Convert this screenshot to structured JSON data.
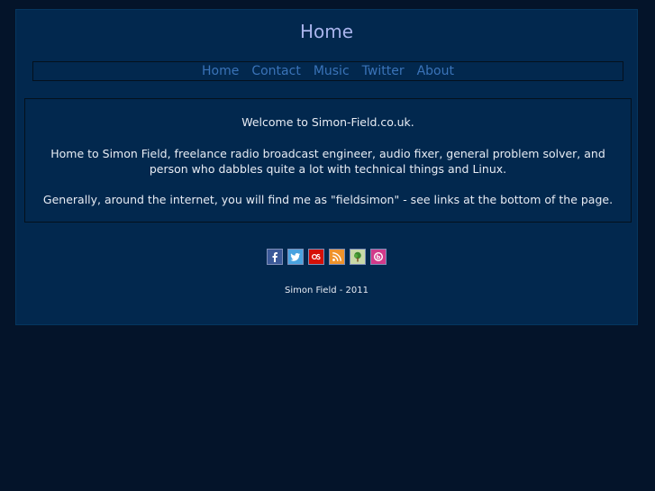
{
  "header": {
    "title": "Home"
  },
  "nav": {
    "items": [
      {
        "label": "Home"
      },
      {
        "label": "Contact"
      },
      {
        "label": "Music"
      },
      {
        "label": "Twitter"
      },
      {
        "label": "About"
      }
    ]
  },
  "content": {
    "welcome": "Welcome to Simon-Field.co.uk.",
    "intro": "Home to Simon Field, freelance radio broadcast engineer, audio fixer, general problem solver, and person who dabbles quite a lot with technical things and Linux.",
    "links_note": "Generally, around the internet, you will find me as \"fieldsimon\" - see links at the bottom of the page."
  },
  "social": {
    "icons": [
      "facebook-icon",
      "twitter-icon",
      "lastfm-icon",
      "rss-icon",
      "tree-icon",
      "blip-icon"
    ]
  },
  "footer": {
    "text": "Simon Field - 2011"
  },
  "colors": {
    "background": "#04142a",
    "panel": "#02284e",
    "title": "#a9b4ec",
    "nav_link": "#3a73b8",
    "text": "#e8ecf4"
  }
}
